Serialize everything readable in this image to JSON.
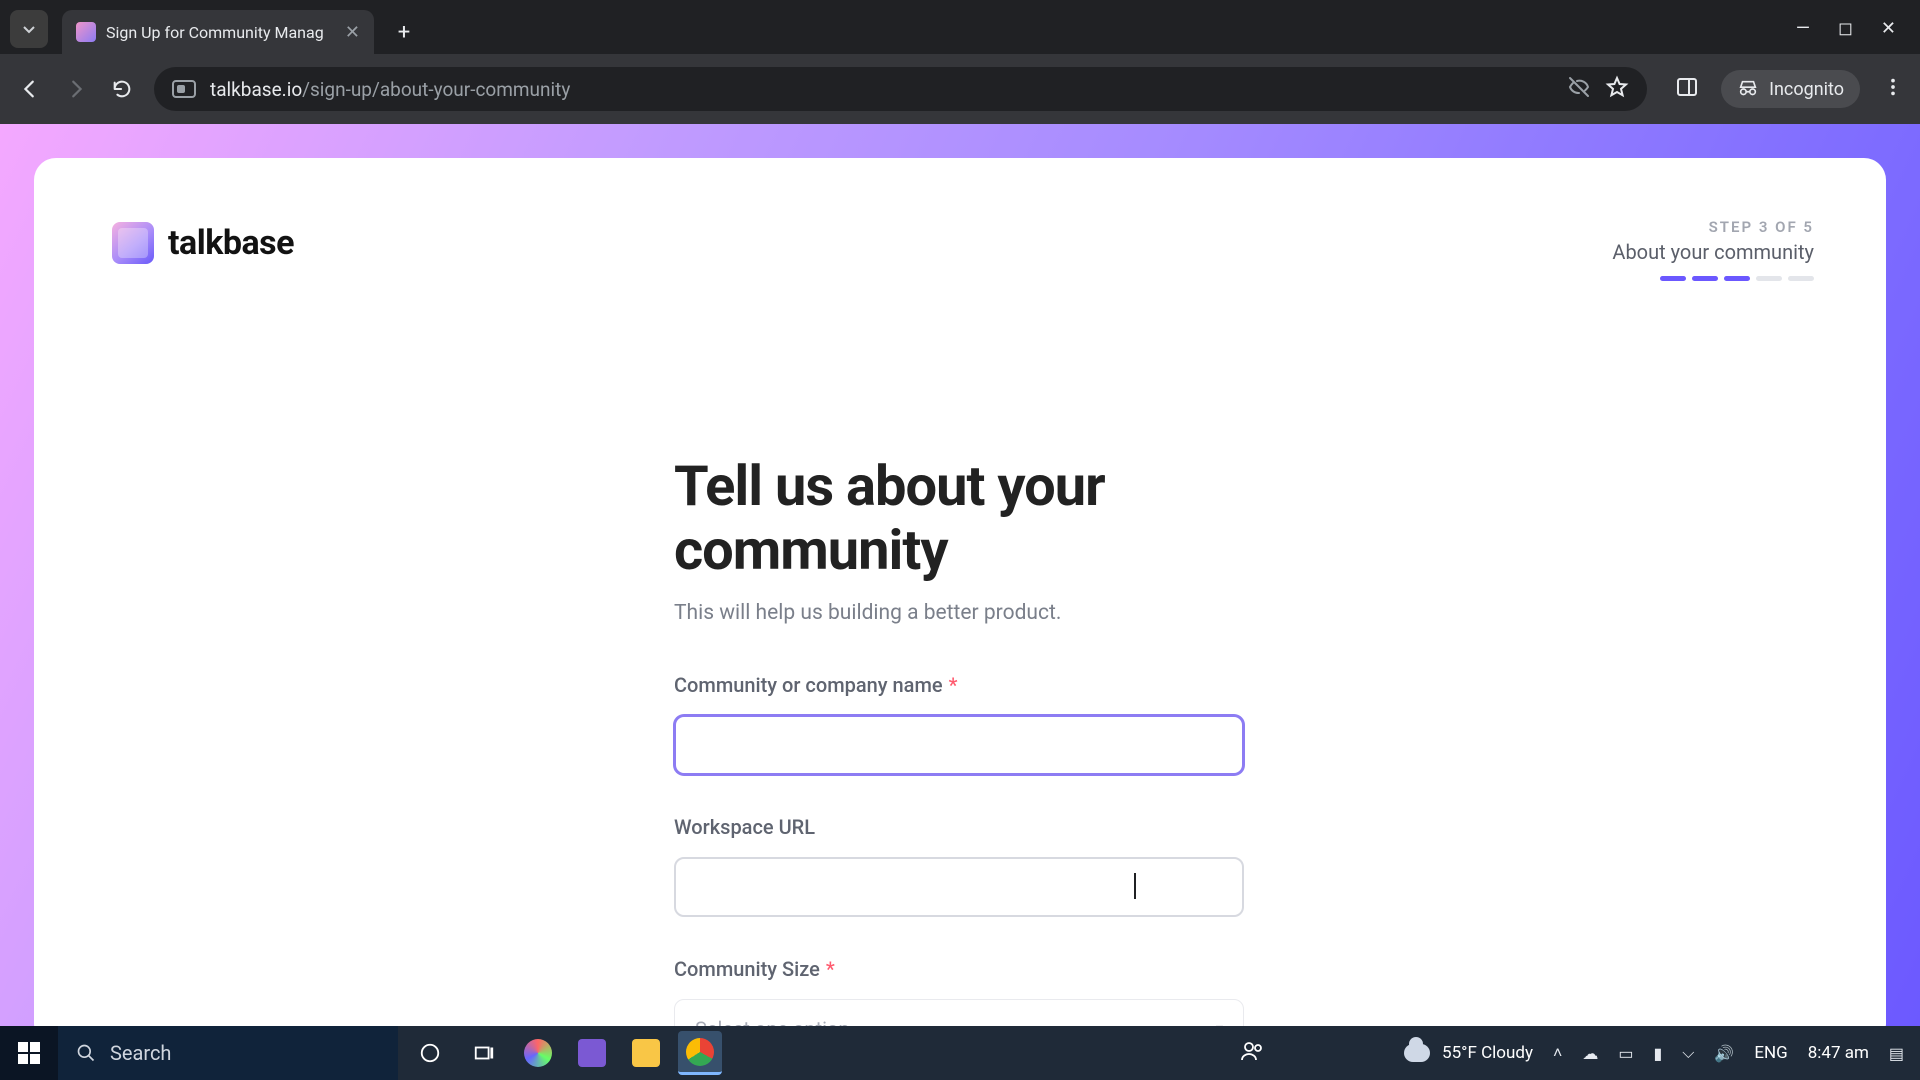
{
  "browser": {
    "tab_title": "Sign Up for Community Manag",
    "url_domain": "talkbase.io",
    "url_path": "/sign-up/about-your-community",
    "incognito_label": "Incognito"
  },
  "brand": {
    "name": "talkbase"
  },
  "step": {
    "label": "STEP 3 OF 5",
    "title": "About your community",
    "completed": 3,
    "total": 5
  },
  "form": {
    "heading": "Tell us about your community",
    "subheading": "This will help us building a better product.",
    "fields": {
      "community_name": {
        "label": "Community or company name",
        "value": "",
        "required": true
      },
      "workspace_url": {
        "label": "Workspace URL",
        "value": "",
        "required": false
      },
      "community_size": {
        "label": "Community Size",
        "placeholder": "Select one option",
        "required": true
      }
    }
  },
  "taskbar": {
    "search_placeholder": "Search",
    "weather": "55°F  Cloudy",
    "lang": "ENG",
    "time": "8:47 am"
  }
}
